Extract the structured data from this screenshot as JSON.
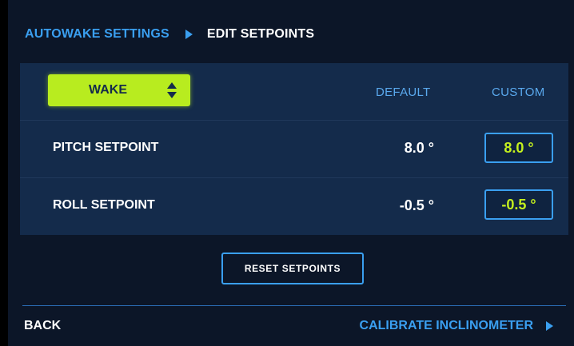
{
  "breadcrumb": {
    "parent": "AUTOWAKE SETTINGS",
    "current": "EDIT SETPOINTS",
    "separator_icon": "triangle-right-icon"
  },
  "mode_select": {
    "value": "WAKE",
    "icon": "up-down-arrows-icon"
  },
  "columns": {
    "default": "DEFAULT",
    "custom": "CUSTOM"
  },
  "rows": [
    {
      "label": "PITCH SETPOINT",
      "default": "8.0 °",
      "custom": "8.0 °"
    },
    {
      "label": "ROLL SETPOINT",
      "default": "-0.5 °",
      "custom": "-0.5 °"
    }
  ],
  "reset_button": "RESET SETPOINTS",
  "footer": {
    "back": "BACK",
    "calibrate": "CALIBRATE INCLINOMETER",
    "calibrate_icon": "triangle-right-icon"
  },
  "colors": {
    "background": "#0c1628",
    "panel": "#142b4b",
    "accent_blue": "#3a9ff0",
    "accent_green": "#b8ec1f",
    "text": "#ffffff"
  }
}
